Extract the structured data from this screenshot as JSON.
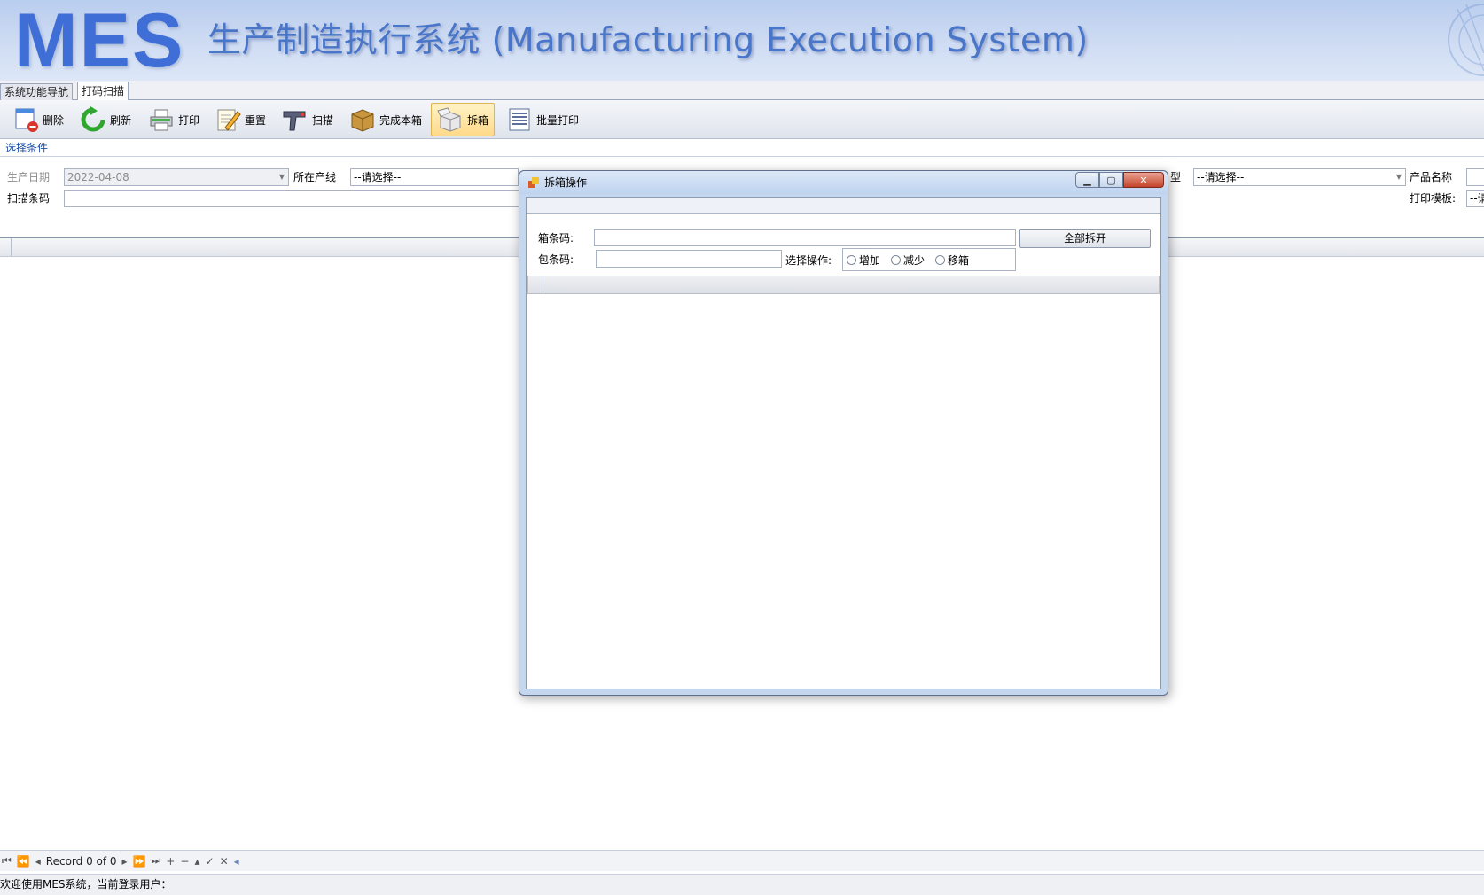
{
  "header": {
    "logo": "MES",
    "title": "生产制造执行系统 (Manufacturing Execution System)"
  },
  "tabs": [
    {
      "label": "系统功能导航",
      "active": false
    },
    {
      "label": "打码扫描",
      "active": true
    }
  ],
  "toolbar": {
    "delete": "删除",
    "refresh": "刷新",
    "print": "打印",
    "reset": "重置",
    "scan": "扫描",
    "complete_box": "完成本箱",
    "unbox": "拆箱",
    "batch_print": "批量打印"
  },
  "conditions": {
    "header": "选择条件",
    "prod_date_label": "生产日期",
    "prod_date_value": "2022-04-08",
    "line_label": "所在产线",
    "line_value": "--请选择--",
    "type_label_partial": "型",
    "type_value": "--请选择--",
    "product_name_label": "产品名称",
    "scan_code_label": "扫描条码",
    "print_template_label": "打印模板:",
    "print_template_value": "--请"
  },
  "dialog": {
    "title": "拆箱操作",
    "box_code_label": "箱条码:",
    "box_code_value": "",
    "pack_code_label": "包条码:",
    "pack_code_value": "",
    "unbox_all_button": "全部拆开",
    "operation_label": "选择操作:",
    "operations": [
      "增加",
      "减少",
      "移箱"
    ]
  },
  "navigator": {
    "record_text": "Record 0 of 0"
  },
  "status": {
    "text": "欢迎使用MES系统，当前登录用户："
  }
}
